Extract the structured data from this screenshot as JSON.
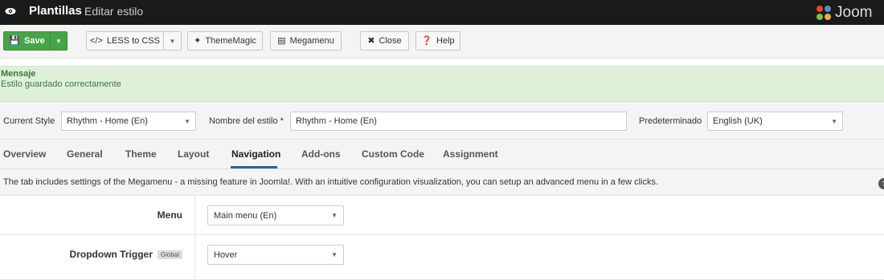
{
  "header": {
    "title": "Plantillas",
    "subtitle": "Editar estilo",
    "logo_text": "Joom"
  },
  "toolbar": {
    "save_label": "Save",
    "less_label": "LESS to CSS",
    "thememagic_label": "ThemeMagic",
    "megamenu_label": "Megamenu",
    "close_label": "Close",
    "help_label": "Help"
  },
  "message": {
    "title": "Mensaje",
    "text": "Estilo guardado correctamente"
  },
  "style_row": {
    "current_style_label": "Current Style",
    "current_style_value": "Rhythm - Home (En)",
    "style_name_label": "Nombre del estilo *",
    "style_name_value": "Rhythm - Home (En)",
    "default_label": "Predeterminado",
    "default_value": "English (UK)"
  },
  "tabs": [
    {
      "label": "Overview"
    },
    {
      "label": "General"
    },
    {
      "label": "Theme"
    },
    {
      "label": "Layout"
    },
    {
      "label": "Navigation"
    },
    {
      "label": "Add-ons"
    },
    {
      "label": "Custom Code"
    },
    {
      "label": "Assignment"
    }
  ],
  "active_tab": "Navigation",
  "description": "The tab includes settings of the Megamenu - a missing feature in Joomla!. With an intuitive configuration visualization, you can setup an advanced menu in a few clicks.",
  "form": {
    "menu_label": "Menu",
    "menu_value": "Main menu (En)",
    "dropdown_label": "Dropdown Trigger",
    "dropdown_badge": "Global",
    "dropdown_value": "Hover"
  },
  "colors": {
    "header_bg": "#1a1a1a",
    "save_green": "#46a546",
    "message_bg": "#dff0d8",
    "active_tab_underline": "#2a6496"
  }
}
